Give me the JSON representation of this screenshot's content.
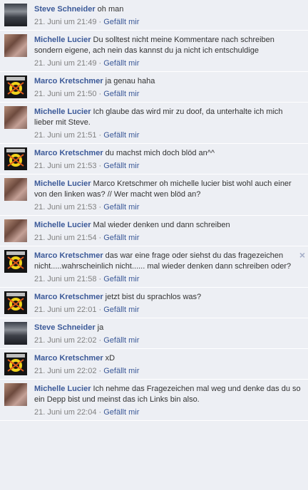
{
  "like_label": "Gefällt mir",
  "meta_sep": " · ",
  "comments": [
    {
      "author": "Steve Schneider",
      "avatar": "steve-avatar",
      "text": "oh man",
      "time": "21. Juni um 21:49"
    },
    {
      "author": "Michelle Lucier",
      "avatar": "michelle-avatar",
      "text": "Du solltest nicht meine Kommentare nach schreiben sondern eigene, ach nein das kannst du ja nicht ich entschuldige",
      "time": "21. Juni um 21:49"
    },
    {
      "author": "Marco Kretschmer",
      "avatar": "marco-avatar",
      "text": "ja genau haha",
      "time": "21. Juni um 21:50"
    },
    {
      "author": "Michelle Lucier",
      "avatar": "michelle-avatar",
      "text": "Ich glaube das wird mir zu doof, da unterhalte ich mich lieber mit Steve.",
      "time": "21. Juni um 21:51"
    },
    {
      "author": "Marco Kretschmer",
      "avatar": "marco-avatar",
      "text": "du machst mich doch blöd an^^",
      "time": "21. Juni um 21:53"
    },
    {
      "author": "Michelle Lucier",
      "avatar": "michelle-avatar",
      "text": "Marco Kretschmer oh michelle lucier bist wohl auch einer von den linken was? // Wer macht wen blöd an?",
      "time": "21. Juni um 21:53"
    },
    {
      "author": "Michelle Lucier",
      "avatar": "michelle-avatar",
      "text": "Mal wieder denken und dann schreiben",
      "time": "21. Juni um 21:54"
    },
    {
      "author": "Marco Kretschmer",
      "avatar": "marco-avatar",
      "text": "das war eine frage oder siehst du das fragezeichen nicht.....wahrscheinlich nicht...... mal wieder denken dann schreiben oder?",
      "time": "21. Juni um 21:58",
      "close": "×"
    },
    {
      "author": "Marco Kretschmer",
      "avatar": "marco-avatar",
      "text": "jetzt bist du sprachlos was?",
      "time": "21. Juni um 22:01"
    },
    {
      "author": "Steve Schneider",
      "avatar": "steve-avatar",
      "text": "ja",
      "time": "21. Juni um 22:02"
    },
    {
      "author": "Marco Kretschmer",
      "avatar": "marco-avatar",
      "text": "xD",
      "time": "21. Juni um 22:02"
    },
    {
      "author": "Michelle Lucier",
      "avatar": "michelle-avatar",
      "text": "Ich nehme das Fragezeichen mal weg und denke das du so ein Depp bist und meinst das ich Links bin also.",
      "time": "21. Juni um 22:04"
    }
  ]
}
